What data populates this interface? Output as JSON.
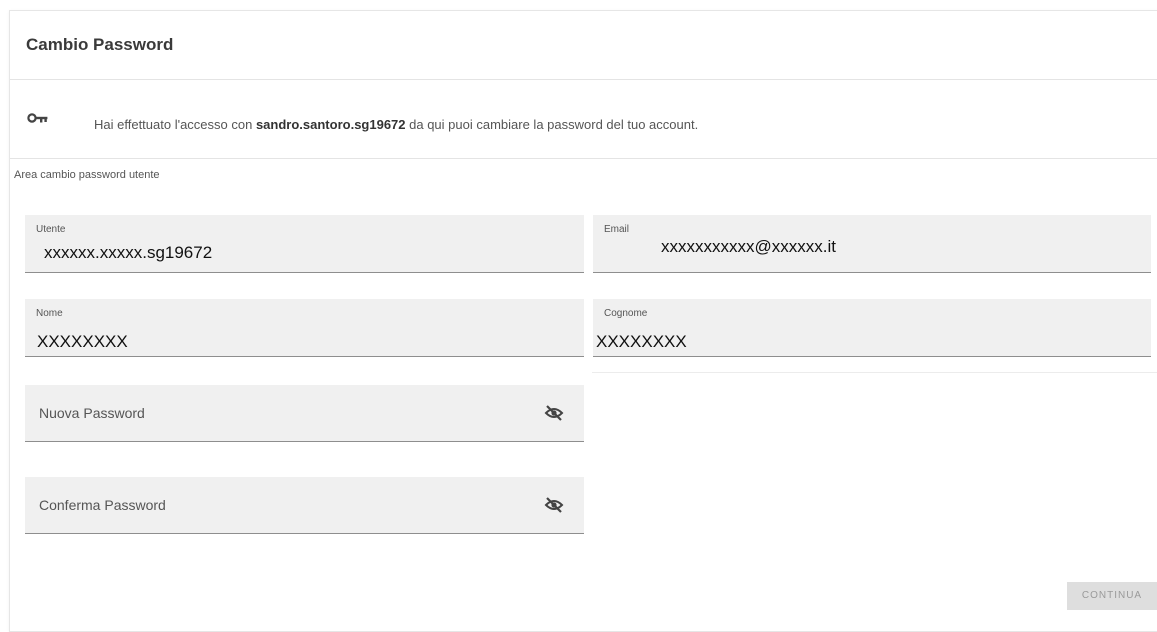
{
  "header": {
    "title": "Cambio Password"
  },
  "info": {
    "icon": "key-icon",
    "text_before": "Hai effettuato l'accesso con ",
    "username": "sandro.santoro.sg19672",
    "text_after": " da qui puoi cambiare la password del tuo account."
  },
  "form": {
    "section_label": "Area cambio password utente",
    "utente": {
      "label": "Utente",
      "value": "xxxxxx.xxxxx.sg19672"
    },
    "email": {
      "label": "Email",
      "value": "xxxxxxxxxxx@xxxxxx.it"
    },
    "nome": {
      "label": "Nome",
      "value": "XXXXXXXX"
    },
    "cognome": {
      "label": "Cognome",
      "value": "XXXXXXXX"
    },
    "nuova_password": {
      "placeholder": "Nuova Password",
      "icon": "eye-off-icon"
    },
    "conferma_password": {
      "placeholder": "Conferma Password",
      "icon": "eye-off-icon"
    }
  },
  "actions": {
    "continue_label": "CONTINUA"
  }
}
